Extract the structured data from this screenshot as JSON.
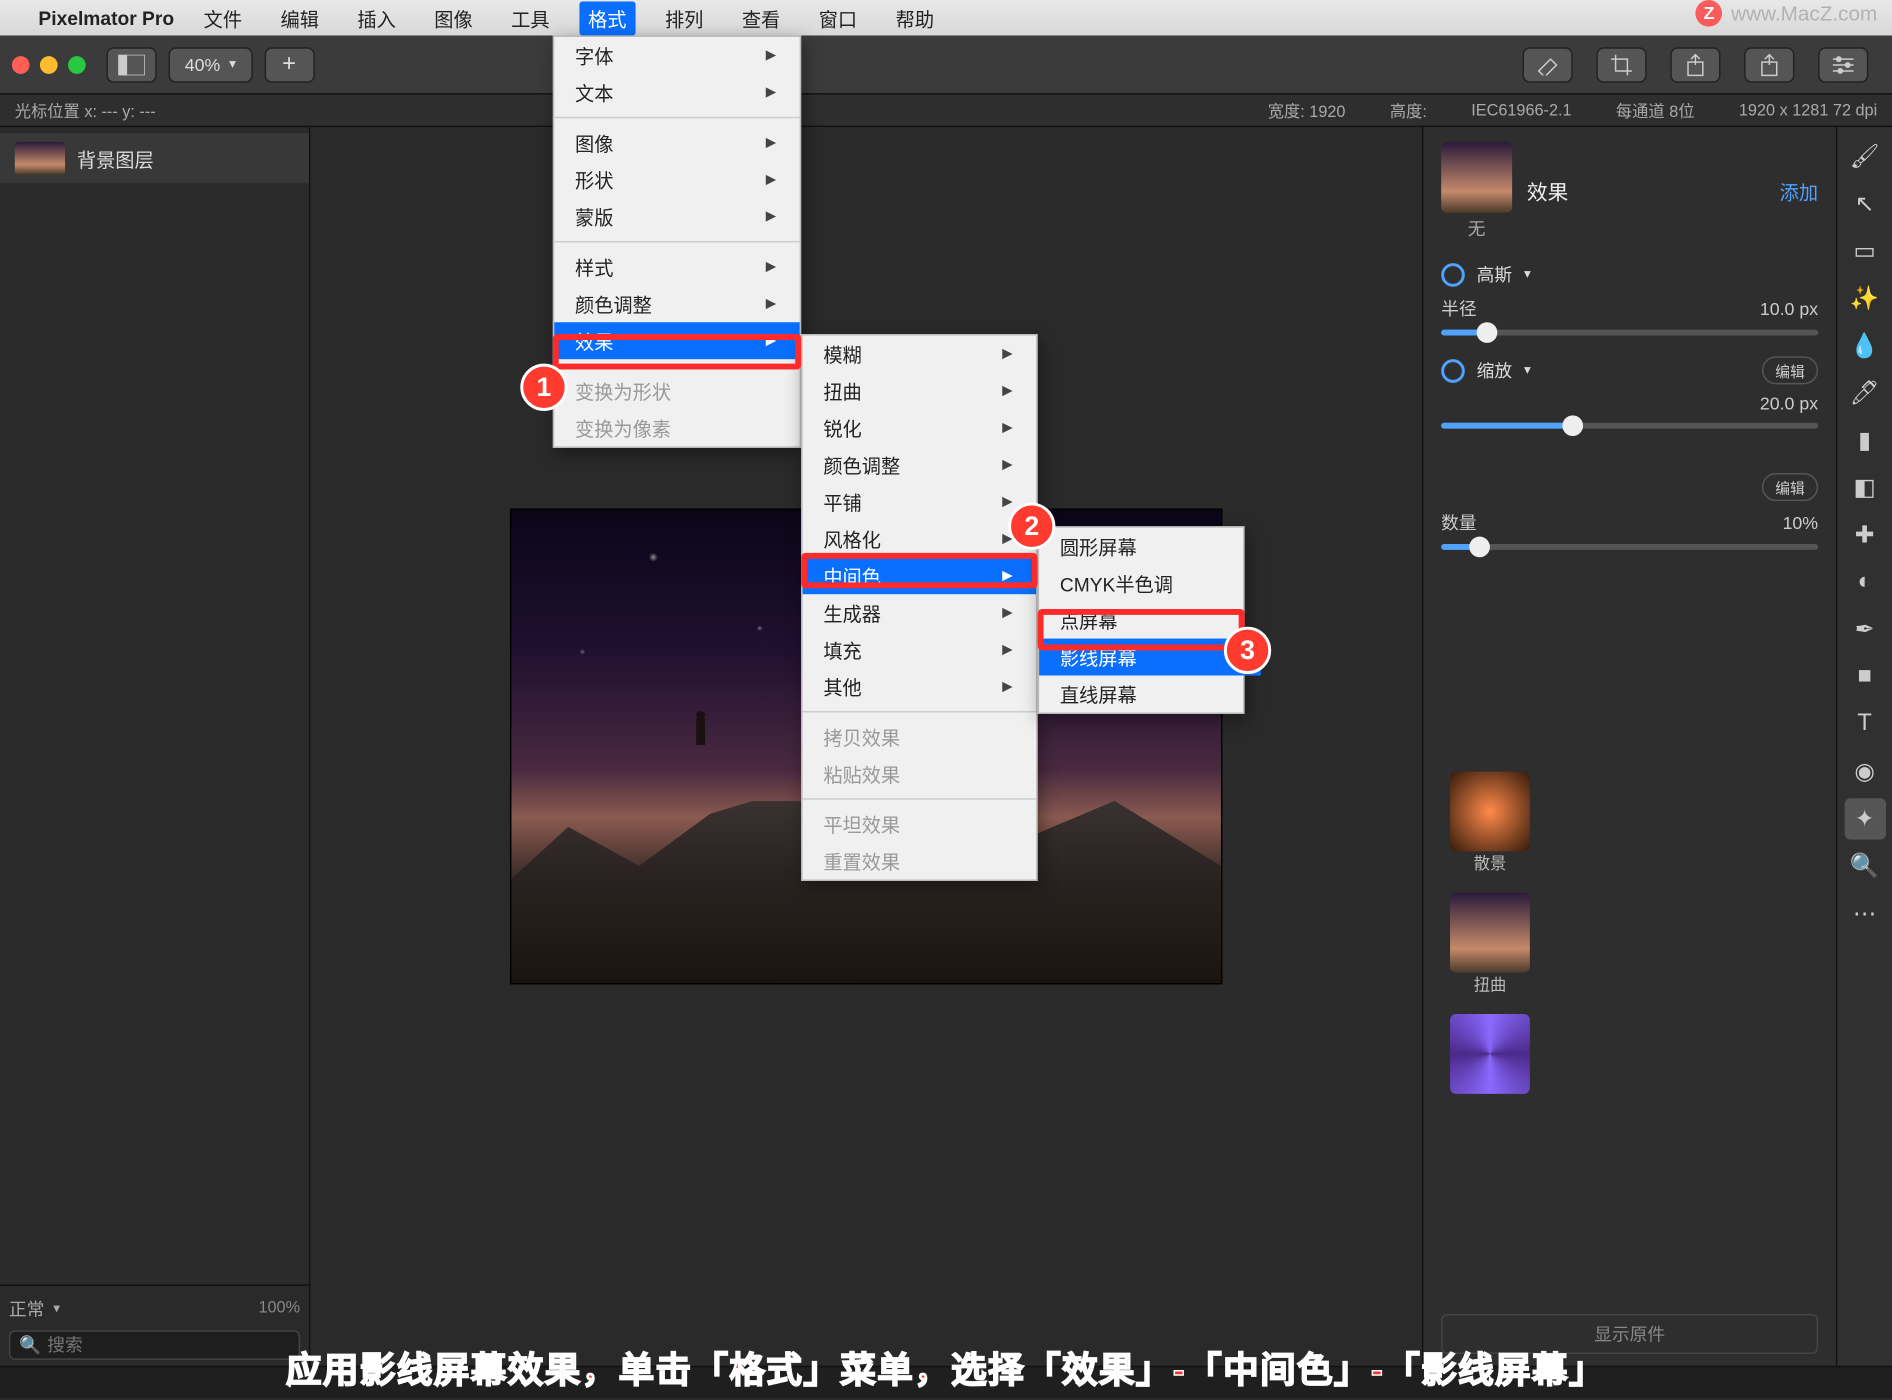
{
  "menubar": {
    "appname": "Pixelmator Pro",
    "items": [
      "文件",
      "编辑",
      "插入",
      "图像",
      "工具",
      "格式",
      "排列",
      "查看",
      "窗口",
      "帮助"
    ],
    "open_index": 5,
    "watermark": "www.MacZ.com"
  },
  "toolbar": {
    "zoom": "40%"
  },
  "info": {
    "cursor": "光标位置 x: ---    y: ---",
    "width": "宽度: 1920",
    "height": "高度:",
    "profile": "IEC61966-2.1",
    "bits": "每通道 8位",
    "dims": "1920 x 1281 72 dpi"
  },
  "layers": {
    "layer0": "背景图层"
  },
  "leftbottom": {
    "mode": "正常",
    "opacity": "100%",
    "search_placeholder": "搜索"
  },
  "format_menu": {
    "font": "字体",
    "text": "文本",
    "image": "图像",
    "shape": "形状",
    "mask": "蒙版",
    "style": "样式",
    "coloradj": "颜色调整",
    "effects": "效果",
    "to_shape": "变换为形状",
    "to_pixel": "变换为像素"
  },
  "effects_menu": {
    "blur": "模糊",
    "distort": "扭曲",
    "sharpen": "锐化",
    "coloradj": "颜色调整",
    "tile": "平铺",
    "stylize": "风格化",
    "halftone": "中间色",
    "generator": "生成器",
    "fill": "填充",
    "other": "其他",
    "copy": "拷贝效果",
    "paste": "粘贴效果",
    "flatten": "平坦效果",
    "reset": "重置效果"
  },
  "halftone_menu": {
    "circle": "圆形屏幕",
    "cmyk": "CMYK半色调",
    "dot": "点屏幕",
    "line": "影线屏幕",
    "straight": "直线屏幕"
  },
  "rightpanel": {
    "title": "效果",
    "add": "添加",
    "none": "无",
    "gauss": "高斯",
    "radius_label": "半径",
    "radius_val": "10.0 px",
    "zoom": "缩放",
    "edit": "编辑",
    "size_val": "20.0 px",
    "amount_label": "数量",
    "amount_val": "10%",
    "preset_bokeh": "散景",
    "preset_distort": "扭曲",
    "show_original": "显示原件"
  },
  "badges": {
    "b1": "1",
    "b2": "2",
    "b3": "3"
  },
  "caption": "应用影线屏幕效果，单击「格式」菜单，选择「效果」-「中间色」-「影线屏幕」"
}
